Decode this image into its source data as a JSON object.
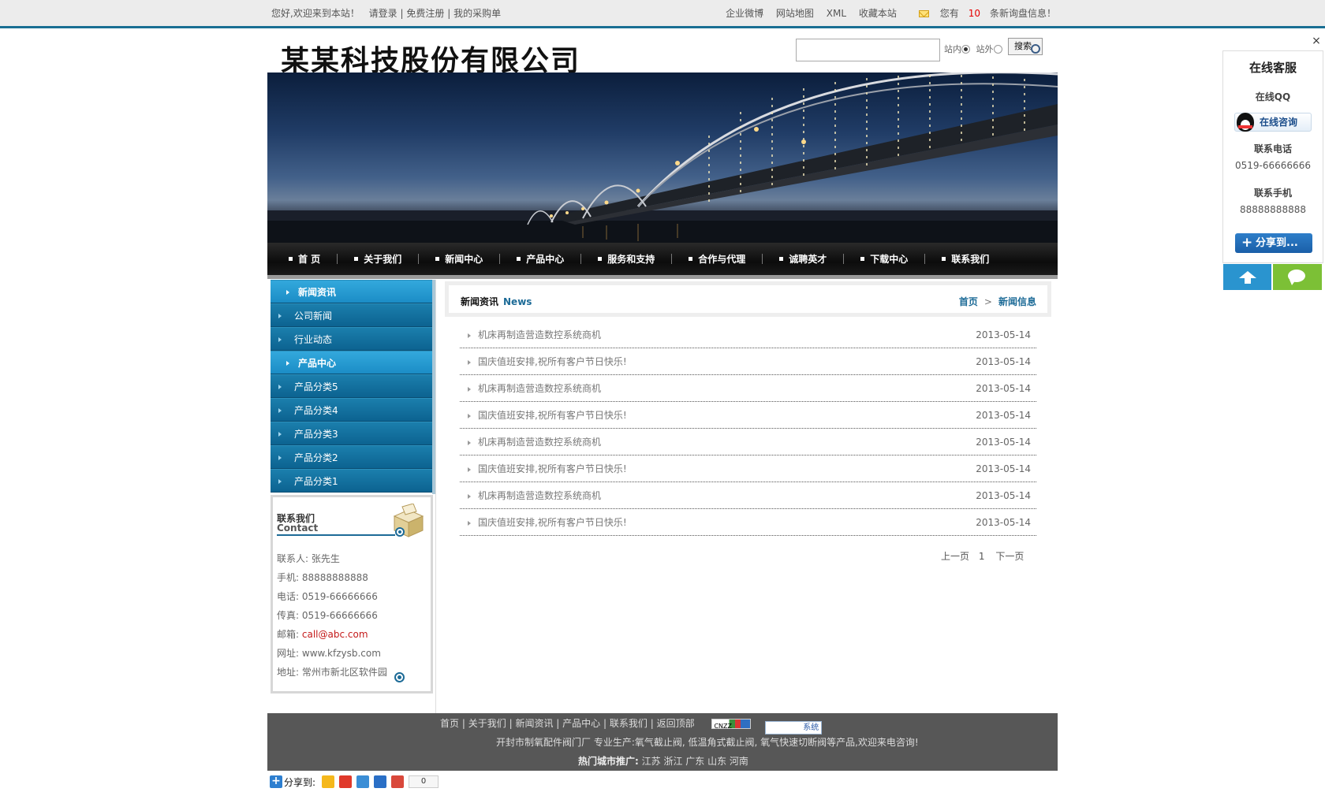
{
  "topbar": {
    "welcome": "您好,欢迎来到本站！",
    "login": "请登录",
    "register": "免费注册",
    "purchase": "我的采购单",
    "sep": "|",
    "weibo": "企业微博",
    "sitemap": "网站地图",
    "xml": "XML",
    "favorite": "收藏本站",
    "inquiry_pre": "您有",
    "inquiry_count": "10",
    "inquiry_post": "条新询盘信息！"
  },
  "header": {
    "logo": "某某科技股份有限公司",
    "search_inside": "站内",
    "search_outside": "站外",
    "search_button": "搜索"
  },
  "nav": {
    "items": [
      "首 页",
      "关于我们",
      "新闻中心",
      "产品中心",
      "服务和支持",
      "合作与代理",
      "诚聘英才",
      "下载中心",
      "联系我们"
    ]
  },
  "sidebar": {
    "news_head": "新闻资讯",
    "news_items": [
      "公司新闻",
      "行业动态"
    ],
    "product_head": "产品中心",
    "product_items": [
      "产品分类5",
      "产品分类4",
      "产品分类3",
      "产品分类2",
      "产品分类1"
    ]
  },
  "contact": {
    "title_cn": "联系我们",
    "title_en": "Contact",
    "person_label": "联系人:",
    "person": "张先生",
    "mobile_label": "手机:",
    "mobile": "88888888888",
    "phone_label": "电话:",
    "phone": "0519-66666666",
    "fax_label": "传真:",
    "fax": "0519-66666666",
    "email_label": "邮箱:",
    "email": "call@abc.com",
    "website_label": "网址:",
    "website": "www.kfzysb.com",
    "address_label": "地址:",
    "address": "常州市新北区软件园"
  },
  "main": {
    "section_cn": "新闻资讯",
    "section_en": "News",
    "crumb_home": "首页",
    "crumb_sep": ">",
    "crumb_current": "新闻信息",
    "news": [
      {
        "title": "机床再制造营造数控系统商机",
        "date": "2013-05-14"
      },
      {
        "title": "国庆值班安排,祝所有客户节日快乐!",
        "date": "2013-05-14"
      },
      {
        "title": "机床再制造营造数控系统商机",
        "date": "2013-05-14"
      },
      {
        "title": "国庆值班安排,祝所有客户节日快乐!",
        "date": "2013-05-14"
      },
      {
        "title": "机床再制造营造数控系统商机",
        "date": "2013-05-14"
      },
      {
        "title": "国庆值班安排,祝所有客户节日快乐!",
        "date": "2013-05-14"
      },
      {
        "title": "机床再制造营造数控系统商机",
        "date": "2013-05-14"
      },
      {
        "title": "国庆值班安排,祝所有客户节日快乐!",
        "date": "2013-05-14"
      }
    ],
    "pager": {
      "prev": "上一页",
      "page": "1",
      "next": "下一页"
    }
  },
  "footer": {
    "links": [
      "首页",
      "关于我们",
      "新闻资讯",
      "产品中心",
      "联系我们",
      "返回顶部"
    ],
    "link_sep": "|",
    "badge1": "CNZZ",
    "badge2": "系统",
    "line2": "开封市制氧配件阀门厂 专业生产:氧气截止阀, 低温角式截止阀, 氧气快速切断阀等产品,欢迎来电咨询!",
    "hot_label": "热门城市推广:",
    "hot_cities": "江苏 浙江 广东 山东 河南"
  },
  "sharebar": {
    "label": "分享到:",
    "count": "0"
  },
  "kefu": {
    "close": "×",
    "title": "在线客服",
    "qq_label": "在线QQ",
    "qq_button": "在线咨询",
    "phone_label": "联系电话",
    "phone": "0519-66666666",
    "mobile_label": "联系手机",
    "mobile": "88888888888",
    "share_button": "分享到..."
  },
  "colors": {
    "accent": "#1d6b97",
    "sidebar_blue": "#0c6391",
    "footer_bg": "#575757",
    "chat_green": "#7cc036",
    "top_blue": "#2a94cf"
  }
}
